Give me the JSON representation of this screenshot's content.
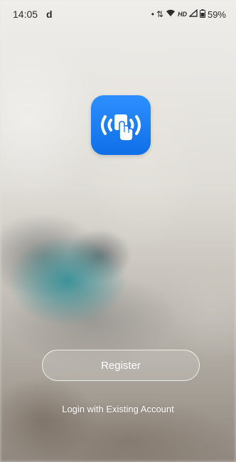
{
  "status_bar": {
    "time": "14:05",
    "app_indicator": "d",
    "network_label": "HD",
    "battery": "59%"
  },
  "app": {
    "logo_icon": "remote-touch-icon",
    "logo_color": "#1a7df5"
  },
  "actions": {
    "register_label": "Register",
    "login_label": "Login with Existing Account"
  }
}
